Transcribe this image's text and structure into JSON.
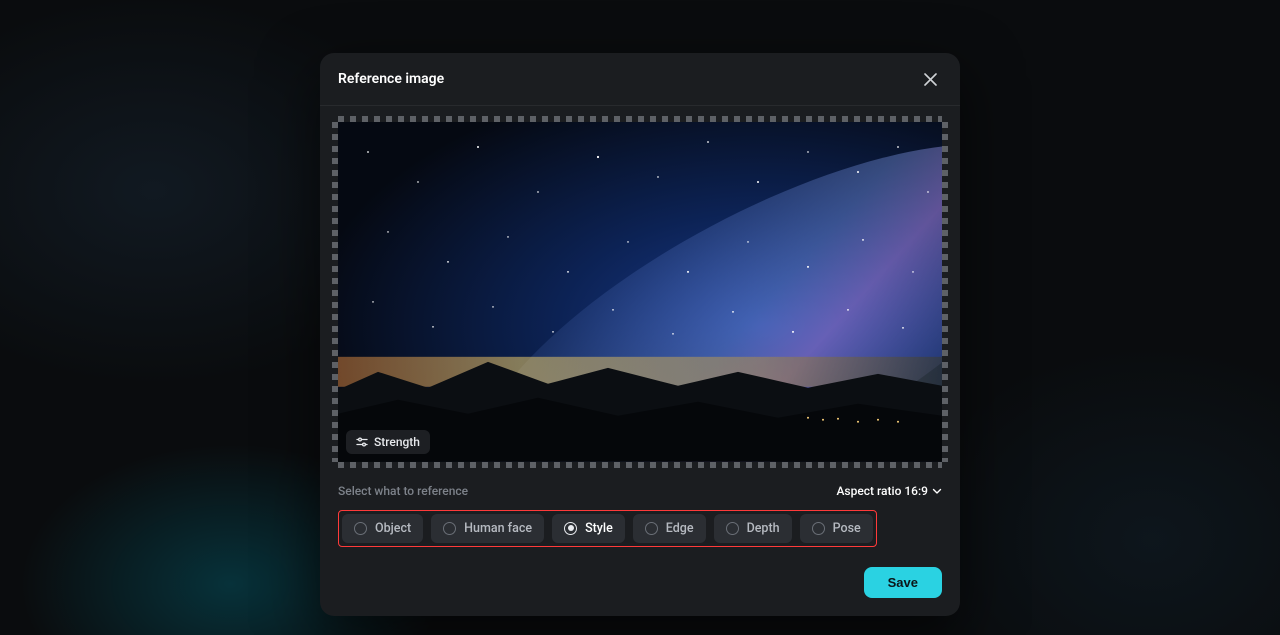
{
  "modal": {
    "title": "Reference image"
  },
  "strength": {
    "label": "Strength"
  },
  "section": {
    "label": "Select what to reference"
  },
  "aspect": {
    "label": "Aspect ratio 16:9"
  },
  "options": [
    {
      "label": "Object",
      "selected": false
    },
    {
      "label": "Human face",
      "selected": false
    },
    {
      "label": "Style",
      "selected": true
    },
    {
      "label": "Edge",
      "selected": false
    },
    {
      "label": "Depth",
      "selected": false
    },
    {
      "label": "Pose",
      "selected": false
    }
  ],
  "footer": {
    "save": "Save"
  },
  "colors": {
    "accent": "#2ad2e2",
    "highlight_border": "#ff3a3a"
  }
}
